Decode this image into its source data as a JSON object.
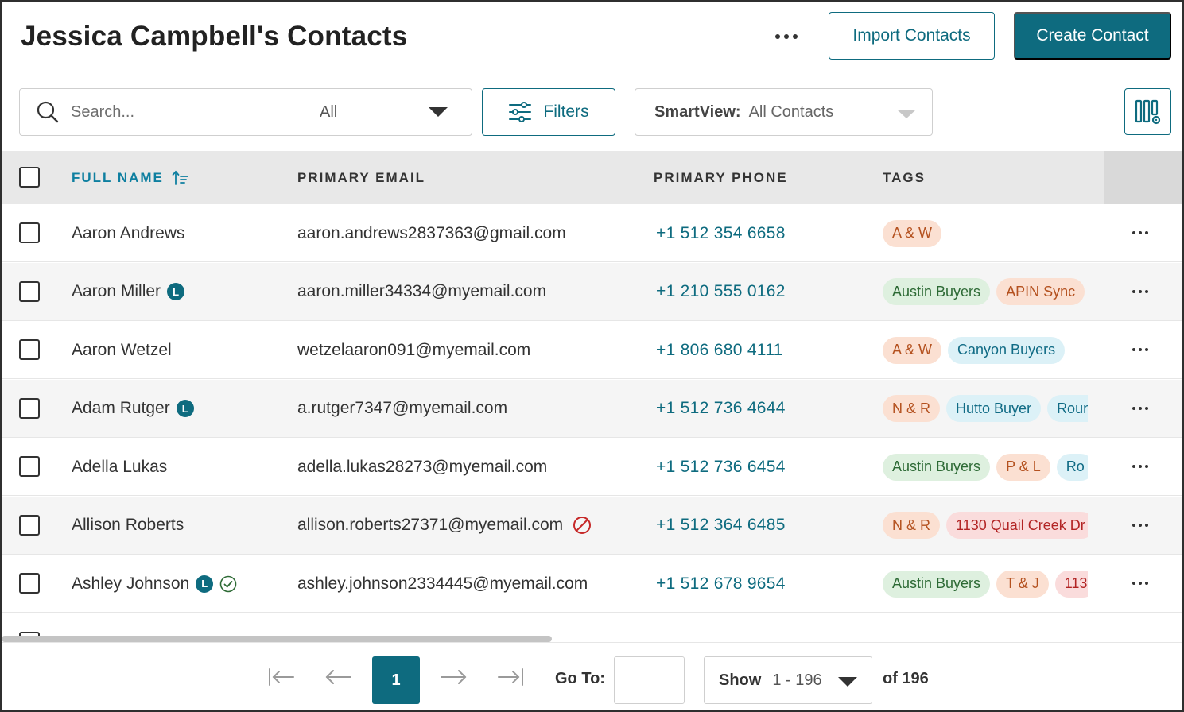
{
  "header": {
    "title": "Jessica Campbell's Contacts",
    "import_label": "Import Contacts",
    "create_label": "Create Contact"
  },
  "toolbar": {
    "search_placeholder": "Search...",
    "scope_value": "All",
    "filters_label": "Filters",
    "smartview_label": "SmartView:",
    "smartview_value": "All Contacts"
  },
  "table": {
    "columns": {
      "full_name": "FULL NAME",
      "primary_email": "PRIMARY EMAIL",
      "primary_phone": "PRIMARY PHONE",
      "tags": "TAGS"
    },
    "sort": {
      "column": "full_name",
      "direction": "ascending"
    },
    "rows": [
      {
        "name": "Aaron Andrews",
        "lead": false,
        "verified": false,
        "email": "aaron.andrews2837363@gmail.com",
        "email_blocked": false,
        "phone": "+1 512 354 6658",
        "tags": [
          {
            "label": "A & W",
            "color": "orange"
          }
        ]
      },
      {
        "name": "Aaron Miller",
        "lead": true,
        "verified": false,
        "email": "aaron.miller34334@myemail.com",
        "email_blocked": false,
        "phone": "+1 210 555 0162",
        "tags": [
          {
            "label": "Austin Buyers",
            "color": "green"
          },
          {
            "label": "APIN Sync",
            "color": "orange"
          }
        ]
      },
      {
        "name": "Aaron Wetzel",
        "lead": false,
        "verified": false,
        "email": "wetzelaaron091@myemail.com",
        "email_blocked": false,
        "phone": "+1 806 680 4111",
        "tags": [
          {
            "label": "A & W",
            "color": "orange"
          },
          {
            "label": "Canyon Buyers",
            "color": "blue"
          }
        ]
      },
      {
        "name": "Adam Rutger",
        "lead": true,
        "verified": false,
        "email": "a.rutger7347@myemail.com",
        "email_blocked": false,
        "phone": "+1 512 736 4644",
        "tags": [
          {
            "label": "N & R",
            "color": "orange"
          },
          {
            "label": "Hutto Buyer",
            "color": "blue"
          },
          {
            "label": "Roun",
            "color": "blue"
          }
        ]
      },
      {
        "name": "Adella Lukas",
        "lead": false,
        "verified": false,
        "email": "adella.lukas28273@myemail.com",
        "email_blocked": false,
        "phone": "+1 512 736 6454",
        "tags": [
          {
            "label": "Austin Buyers",
            "color": "green"
          },
          {
            "label": "P & L",
            "color": "orange"
          },
          {
            "label": "Ro",
            "color": "blue"
          }
        ]
      },
      {
        "name": "Allison Roberts",
        "lead": false,
        "verified": false,
        "email": "allison.roberts27371@myemail.com",
        "email_blocked": true,
        "phone": "+1 512 364 6485",
        "tags": [
          {
            "label": "N & R",
            "color": "orange"
          },
          {
            "label": "1130 Quail Creek Dr",
            "color": "red"
          }
        ]
      },
      {
        "name": "Ashley Johnson",
        "lead": true,
        "verified": true,
        "email": "ashley.johnson2334445@myemail.com",
        "email_blocked": false,
        "phone": "+1 512 678 9654",
        "tags": [
          {
            "label": "Austin Buyers",
            "color": "green"
          },
          {
            "label": "T & J",
            "color": "orange"
          },
          {
            "label": "113",
            "color": "red"
          }
        ]
      }
    ],
    "lead_badge_label": "L"
  },
  "pagination": {
    "current_page": "1",
    "goto_label": "Go To:",
    "goto_value": "",
    "show_label": "Show",
    "show_value": "1 - 196",
    "total_text": "of 196"
  },
  "colors": {
    "brand": "#0e6b7f",
    "tag_orange_bg": "#fbe0d2",
    "tag_green_bg": "#def0df",
    "tag_blue_bg": "#dcf1f7",
    "tag_red_bg": "#fadcdc"
  },
  "icons": {
    "search": "search-icon",
    "filters": "sliders-icon",
    "columns": "column-settings-icon",
    "more": "more-horizontal-icon",
    "sort": "sort-ascending-icon",
    "blocked": "blocked-icon",
    "verified": "verified-check-icon"
  }
}
